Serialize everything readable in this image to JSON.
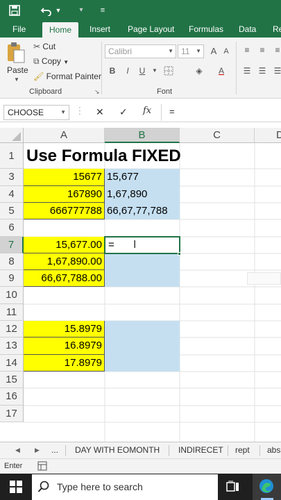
{
  "qat": {
    "save_icon": "save-icon",
    "undo_icon": "undo-icon",
    "customize_icon": "customize-icon"
  },
  "tabs": [
    "File",
    "Home",
    "Insert",
    "Page Layout",
    "Formulas",
    "Data",
    "Re"
  ],
  "ribbon": {
    "paste_label": "Paste",
    "cut_label": "Cut",
    "copy_label": "Copy",
    "format_painter_label": "Format Painter",
    "clipboard_group": "Clipboard",
    "font_name": "Calibri",
    "font_size": "11",
    "bold": "B",
    "italic": "I",
    "underline": "U",
    "grow_font": "A",
    "shrink_font": "A",
    "font_color": "A",
    "font_group": "Font"
  },
  "formula_bar": {
    "name_box": "CHOOSE",
    "fx": "fx",
    "cancel": "✕",
    "enter": "✓",
    "formula": "="
  },
  "columns": [
    "A",
    "B",
    "C",
    "D"
  ],
  "rows": [
    "1",
    "3",
    "4",
    "5",
    "6",
    "7",
    "8",
    "9",
    "10",
    "11",
    "12",
    "13",
    "14",
    "15",
    "16",
    "17"
  ],
  "cells": {
    "title": "Use Formula FIXED",
    "a3": "15677",
    "b3": "15,677",
    "a4": "167890",
    "b4": "1,67,890",
    "a5": "666777788",
    "b5": "66,67,77,788",
    "a7": "15,677.00",
    "b7": "=",
    "a8": "1,67,890.00",
    "a9": "66,67,788.00",
    "a11": "15.8979",
    "a12": "16.8979",
    "a13": "17.8979"
  },
  "sheet_tabs": {
    "more": "...",
    "tabs": [
      "DAY WITH EOMONTH",
      "INDIRECET",
      "rept",
      "abs"
    ]
  },
  "status": {
    "mode": "Enter"
  },
  "taskbar": {
    "search_placeholder": "Type here to search"
  },
  "colors": {
    "excel_green": "#217346",
    "yellow_fill": "#ffff00",
    "blue_fill": "#c5dff1"
  }
}
